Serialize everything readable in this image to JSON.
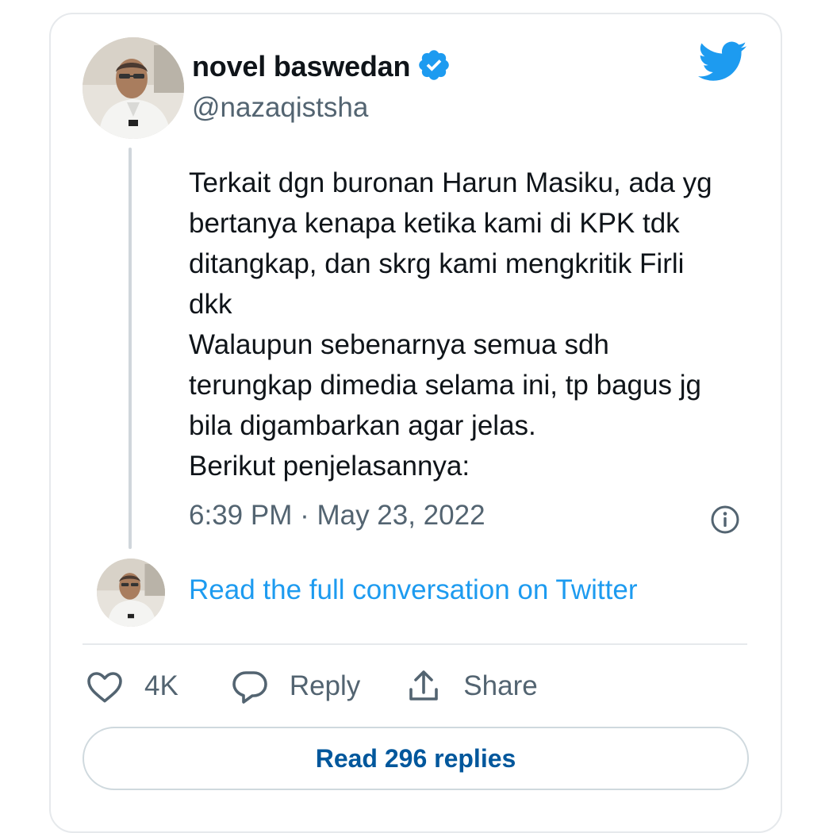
{
  "tweet": {
    "author_name": "novel baswedan",
    "handle": "@nazaqistsha",
    "text": "Terkait dgn buronan Harun Masiku, ada yg\nbertanya kenapa ketika kami di KPK tdk\nditangkap, dan skrg kami mengkritik Firli\ndkk\nWalaupun sebenarnya semua sdh\nterungkap dimedia selama ini, tp bagus jg\nbila digambarkan agar jelas.\nBerikut penjelasannya:",
    "timestamp": "6:39 PM · May 23, 2022"
  },
  "conversation": {
    "link_label": "Read the full conversation on Twitter"
  },
  "actions": {
    "like_count": "4K",
    "reply_label": "Reply",
    "share_label": "Share"
  },
  "replies_button": {
    "label": "Read 296 replies"
  },
  "icons": {
    "verified": "verified-badge-icon",
    "brand": "twitter-bird-icon",
    "info": "info-icon",
    "like": "heart-icon",
    "reply": "speech-bubble-icon",
    "share": "share-upload-icon"
  },
  "colors": {
    "twitter_blue": "#1d9bf0",
    "secondary_text": "#536471",
    "button_text": "#00579c",
    "border": "#e6e9ec"
  }
}
